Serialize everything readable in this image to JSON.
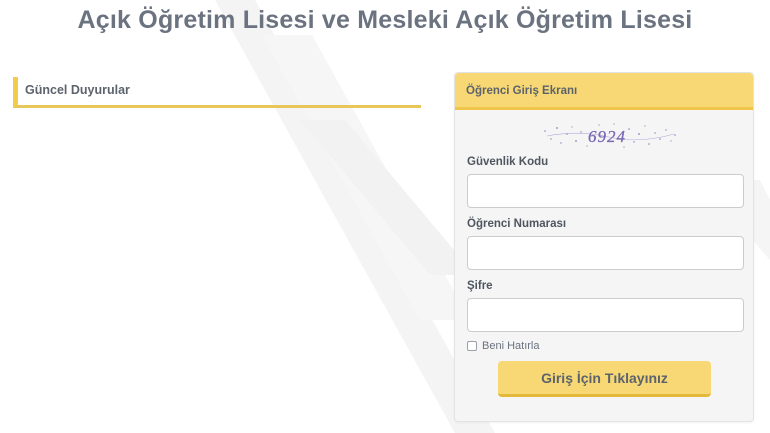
{
  "page": {
    "title": "Açık Öğretim Lisesi ve Mesleki Açık Öğretim Lisesi"
  },
  "news": {
    "title": "Güncel Duyurular"
  },
  "login": {
    "title": "Öğrenci Giriş Ekranı",
    "captcha_text": "6924",
    "security_code_label": "Güvenlik Kodu",
    "security_code_value": "",
    "student_number_label": "Öğrenci Numarası",
    "student_number_value": "",
    "password_label": "Şifre",
    "password_value": "",
    "remember_label": "Beni Hatırla",
    "remember_checked": false,
    "submit_label": "Giriş İçin Tıklayınız"
  },
  "colors": {
    "accent_yellow": "#f7d874",
    "accent_border": "#f0c64a",
    "title_gray": "#6b7380"
  }
}
